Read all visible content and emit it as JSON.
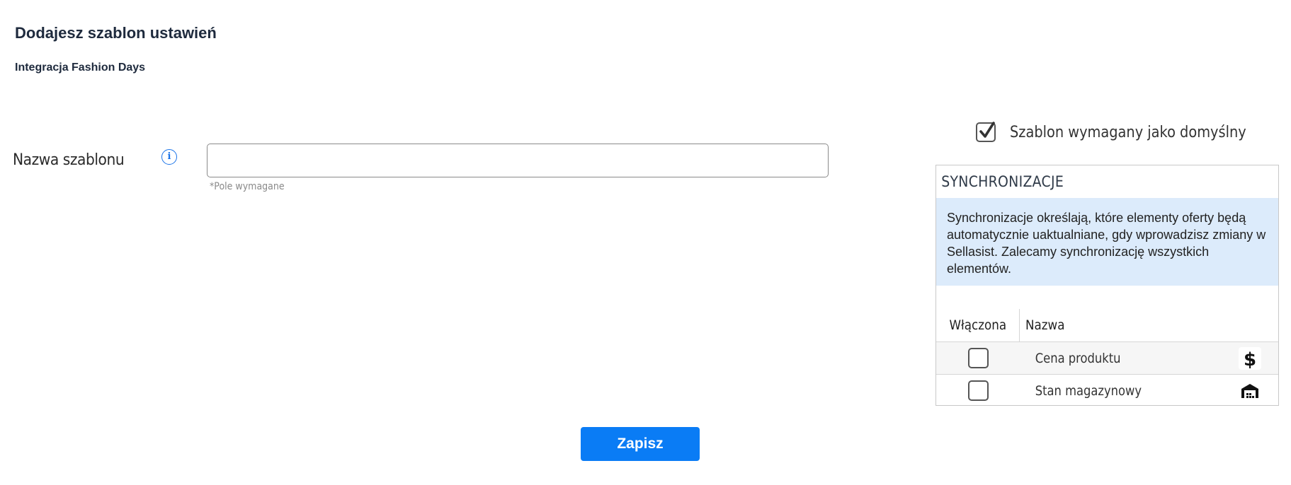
{
  "header": {
    "title": "Dodajesz szablon ustawień",
    "subtitle": "Integracja Fashion Days"
  },
  "form": {
    "name_label": "Nazwa szablonu",
    "info_icon": "info-icon",
    "name_value": "",
    "name_placeholder": "",
    "required_hint": "*Pole wymagane"
  },
  "default_option": {
    "label": "Szablon wymagany jako domyślny",
    "checked": true
  },
  "sync": {
    "title": "SYNCHRONIZACJE",
    "info": "Synchronizacje określają, które elementy oferty będą automatycznie uaktualniane, gdy wprowadzisz zmiany w Sellasist. Zalecamy synchronizację wszystkich elementów.",
    "columns": [
      "Włączona",
      "Nazwa"
    ],
    "rows": [
      {
        "name": "Cena produktu",
        "enabled": false,
        "icon": "dollar-icon"
      },
      {
        "name": "Stan magazynowy",
        "enabled": false,
        "icon": "warehouse-icon"
      }
    ]
  },
  "actions": {
    "save_label": "Zapisz"
  },
  "colors": {
    "accent": "#0a7cf5",
    "info_background": "#dcebfb",
    "title": "#1e2a3d"
  }
}
